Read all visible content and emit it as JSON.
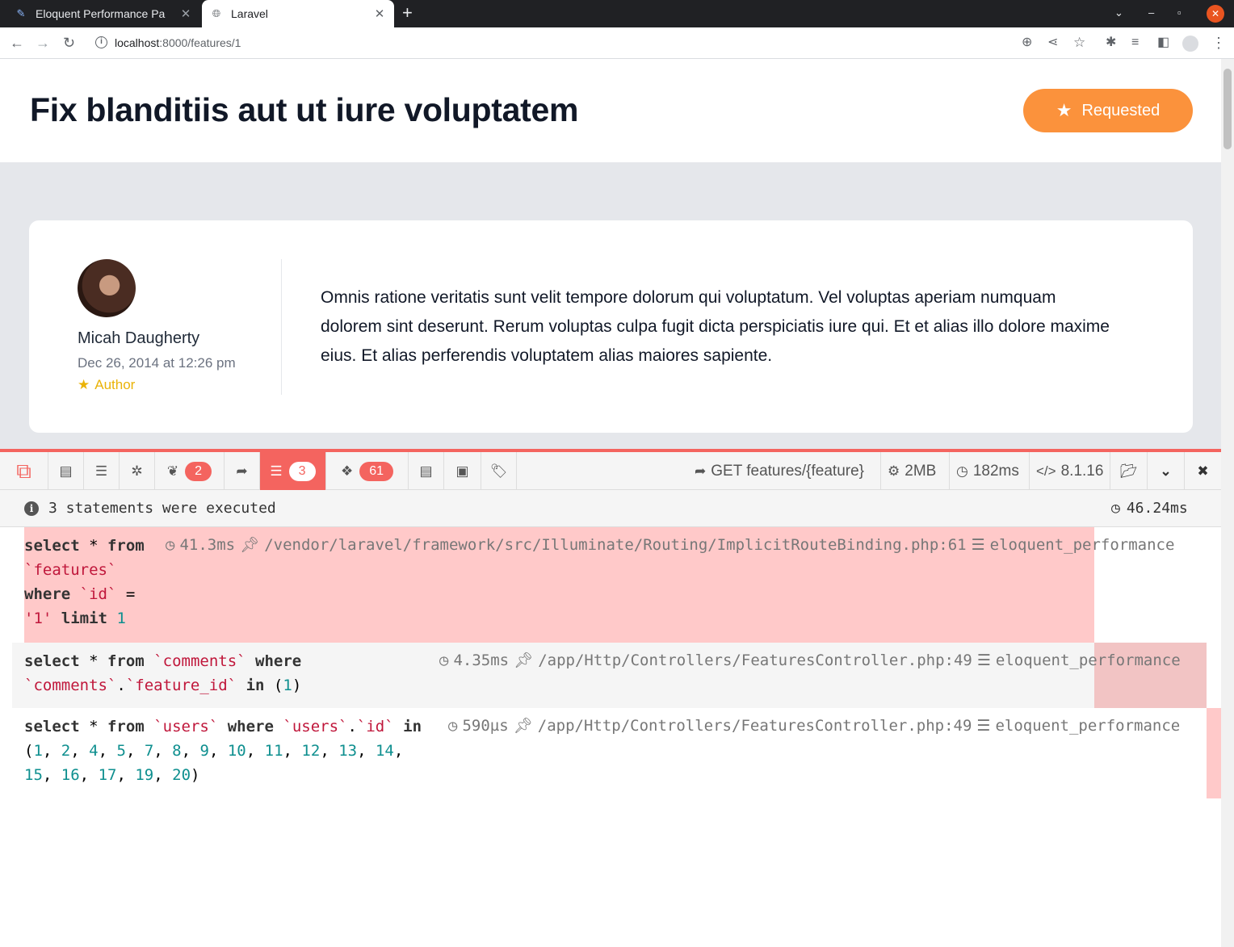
{
  "browser": {
    "tabs": [
      {
        "title": "Eloquent Performance Pa",
        "active": false
      },
      {
        "title": "Laravel",
        "active": true
      }
    ],
    "url_host": "localhost",
    "url_rest": ":8000/features/1"
  },
  "header": {
    "title": "Fix blanditiis aut ut iure voluptatem",
    "button_label": "Requested"
  },
  "comment": {
    "author": "Micah Daugherty",
    "date": "Dec 26, 2014 at 12:26 pm",
    "role": "Author",
    "body": "Omnis ratione veritatis sunt velit tempore dolorum qui voluptatum. Vel voluptas aperiam numquam dolorem sint deserunt. Rerum voluptas culpa fugit dicta perspiciatis iure qui. Et et alias illo dolore maxime eius. Et alias perferendis voluptatem alias maiores sapiente."
  },
  "debugbar": {
    "badges": {
      "views": "2",
      "queries": "3",
      "models": "61"
    },
    "route": "GET features/{feature}",
    "memory": "2MB",
    "time": "182ms",
    "php": "8.1.16",
    "summary": "3 statements were executed",
    "total_time": "46.24ms",
    "statements": [
      {
        "duration": "41.3ms",
        "source": "/vendor/laravel/framework/src/Illuminate/Routing/ImplicitRouteBinding.php:61",
        "connection": "eloquent_performance"
      },
      {
        "duration": "4.35ms",
        "source": "/app/Http/Controllers/FeaturesController.php:49",
        "connection": "eloquent_performance"
      },
      {
        "duration": "590µs",
        "source": "/app/Http/Controllers/FeaturesController.php:49",
        "connection": "eloquent_performance"
      }
    ]
  },
  "colors": {
    "accent_orange": "#fb923c",
    "debugbar_red": "#f4645f",
    "slow_query_bg": "#ffc9c9"
  }
}
